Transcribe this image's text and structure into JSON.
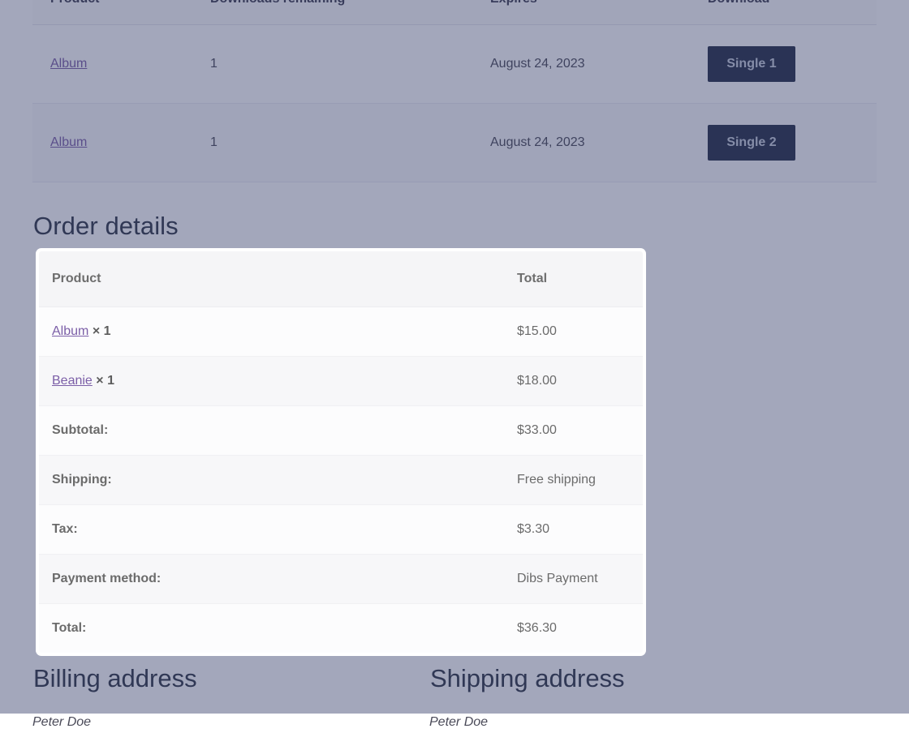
{
  "downloads": {
    "columns": [
      "Product",
      "Downloads remaining",
      "Expires",
      "Download"
    ],
    "rows": [
      {
        "product": "Album",
        "remaining": "1",
        "expires": "August 24, 2023",
        "download_label": "Single 1"
      },
      {
        "product": "Album",
        "remaining": "1",
        "expires": "August 24, 2023",
        "download_label": "Single 2"
      }
    ]
  },
  "order_details": {
    "heading": "Order details",
    "columns": [
      "Product",
      "Total"
    ],
    "items": [
      {
        "name": "Album",
        "qty": "× 1",
        "total": "$15.00"
      },
      {
        "name": "Beanie",
        "qty": "× 1",
        "total": "$18.00"
      }
    ],
    "summary": [
      {
        "label": "Subtotal:",
        "value": "$33.00"
      },
      {
        "label": "Shipping:",
        "value": "Free shipping"
      },
      {
        "label": "Tax:",
        "value": "$3.30"
      },
      {
        "label": "Payment method:",
        "value": "Dibs Payment"
      },
      {
        "label": "Total:",
        "value": "$36.30"
      }
    ]
  },
  "addresses": {
    "billing": {
      "heading": "Billing address",
      "name": "Peter Doe"
    },
    "shipping": {
      "heading": "Shipping address",
      "name": "Peter Doe"
    }
  },
  "colors": {
    "highlight_border": "#2b55dd",
    "button_bg": "#232c46",
    "button_text": "#c9cfdd",
    "link": "#7b5ea7",
    "scrim": "rgba(52,60,105,0.45)"
  }
}
